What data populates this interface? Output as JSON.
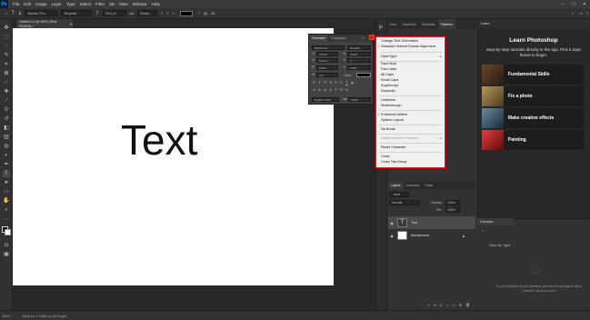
{
  "menubar": {
    "items": [
      "File",
      "Edit",
      "Image",
      "Layer",
      "Type",
      "Select",
      "Filter",
      "3D",
      "View",
      "Window",
      "Help"
    ],
    "logo": "Ps"
  },
  "optbar": {
    "font": "Myriad Pro",
    "style": "Regular",
    "size": "75.5 pt",
    "aa": "Sharp"
  },
  "document": {
    "tab_title": "Untitled-1 @ 66% (Text, RGB/8) *",
    "canvas_text": "Text",
    "zoom_status": "66%",
    "doc_size": "1545 px x 1085 px (300 ppi)"
  },
  "character_panel": {
    "tab_character": "Character",
    "tab_paragraph": "Paragraph",
    "font": "Myriad Pro",
    "style": "Regular",
    "size": "75.5 pt",
    "leading": "(Auto)",
    "kerning": "Metrics",
    "tracking": "0",
    "vscale": "100%",
    "hscale": "100%",
    "baseline": "0 pt",
    "color_label": "Color:",
    "language": "English: USA",
    "aa": "Sharp"
  },
  "flyout_menu": {
    "items": [
      {
        "label": "Change Text Orientation",
        "checked": false,
        "disabled": false
      },
      {
        "label": "Standard Vertical Roman Alignment",
        "checked": true,
        "disabled": false
      },
      {
        "label": "OpenType",
        "checked": false,
        "disabled": false,
        "submenu": true
      },
      {
        "label": "Faux Bold",
        "checked": false,
        "disabled": false
      },
      {
        "label": "Faux Italic",
        "checked": false,
        "disabled": false
      },
      {
        "label": "All Caps",
        "checked": false,
        "disabled": false
      },
      {
        "label": "Small Caps",
        "checked": false,
        "disabled": false
      },
      {
        "label": "Superscript",
        "checked": false,
        "disabled": false
      },
      {
        "label": "Subscript",
        "checked": false,
        "disabled": false
      },
      {
        "label": "Underline",
        "checked": false,
        "disabled": false
      },
      {
        "label": "Strikethrough",
        "checked": false,
        "disabled": false
      },
      {
        "label": "Fractional Widths",
        "checked": true,
        "disabled": false
      },
      {
        "label": "System Layout",
        "checked": false,
        "disabled": false
      },
      {
        "label": "No Break",
        "checked": false,
        "disabled": false
      },
      {
        "label": "Middle Eastern Features",
        "checked": false,
        "disabled": true,
        "submenu": true
      },
      {
        "label": "Reset Character",
        "checked": false,
        "disabled": false
      },
      {
        "label": "Close",
        "checked": false,
        "disabled": false
      },
      {
        "label": "Close Tab Group",
        "checked": false,
        "disabled": false
      }
    ]
  },
  "swatch_tabs": [
    "Color",
    "Swatches",
    "Gradients",
    "Patterns"
  ],
  "layers_panel": {
    "tabs": [
      "Layers",
      "Channels",
      "Paths"
    ],
    "kind": "Kind",
    "blend": "Normal",
    "opacity_label": "Opacity:",
    "opacity": "100%",
    "fill_label": "Fill:",
    "fill": "100%",
    "layers": [
      {
        "name": "Text",
        "type": "text"
      },
      {
        "name": "Background",
        "type": "bg"
      }
    ]
  },
  "learn_panel": {
    "tab": "Learn",
    "title": "Learn Photoshop",
    "subtitle": "Step-by-step tutorials directly in the app. Pick a topic below to begin.",
    "cards": [
      {
        "label": "Fundamental Skills",
        "color": "#3a2a1e"
      },
      {
        "label": "Fix a photo",
        "color": "#5a4a2a"
      },
      {
        "label": "Make creative effects",
        "color": "#2a3a4a"
      },
      {
        "label": "Painting",
        "color": "#8a1a1a"
      }
    ]
  },
  "libraries_panel": {
    "tab": "Libraries",
    "view_by": "View by Type",
    "note": "To use Creative Cloud Libraries, you need to be signed into a Creative Cloud account."
  }
}
